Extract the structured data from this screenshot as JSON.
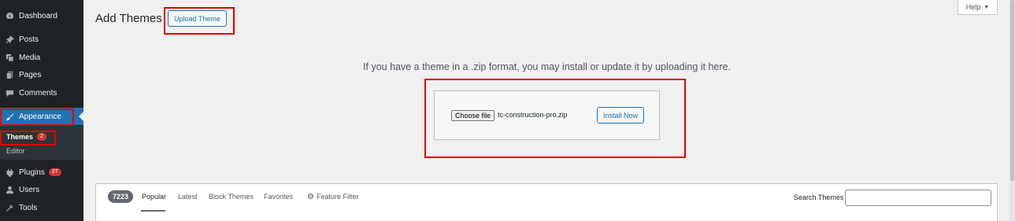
{
  "sidebar": {
    "items": [
      {
        "label": "Dashboard",
        "icon": "dashboard-icon"
      },
      {
        "label": "Posts",
        "icon": "pin-icon"
      },
      {
        "label": "Media",
        "icon": "media-icon"
      },
      {
        "label": "Pages",
        "icon": "pages-icon"
      },
      {
        "label": "Comments",
        "icon": "comment-icon"
      },
      {
        "label": "Appearance",
        "icon": "brush-icon"
      },
      {
        "label": "Plugins",
        "icon": "plugin-icon",
        "badge": "27"
      },
      {
        "label": "Users",
        "icon": "user-icon"
      },
      {
        "label": "Tools",
        "icon": "wrench-icon"
      }
    ],
    "submenu": [
      {
        "label": "Themes",
        "badge": "2"
      },
      {
        "label": "Editor"
      }
    ]
  },
  "header": {
    "title": "Add Themes",
    "upload_button": "Upload Theme",
    "help": "Help",
    "help_arrow": "▼"
  },
  "upload": {
    "intro": "If you have a theme in a .zip format, you may install or update it by uploading it here.",
    "choose_file": "Choose file",
    "file_name": "tc-construction-pro.zip",
    "install_button": "Install Now"
  },
  "filters": {
    "count": "7223",
    "links": [
      "Popular",
      "Latest",
      "Block Themes",
      "Favorites",
      "Feature Filter"
    ],
    "search_label": "Search Themes",
    "search_value": ""
  },
  "colors": {
    "sidebar_bg": "#1d2327",
    "accent": "#2271b1",
    "highlight_box": "#e00000",
    "badge": "#d63638"
  }
}
